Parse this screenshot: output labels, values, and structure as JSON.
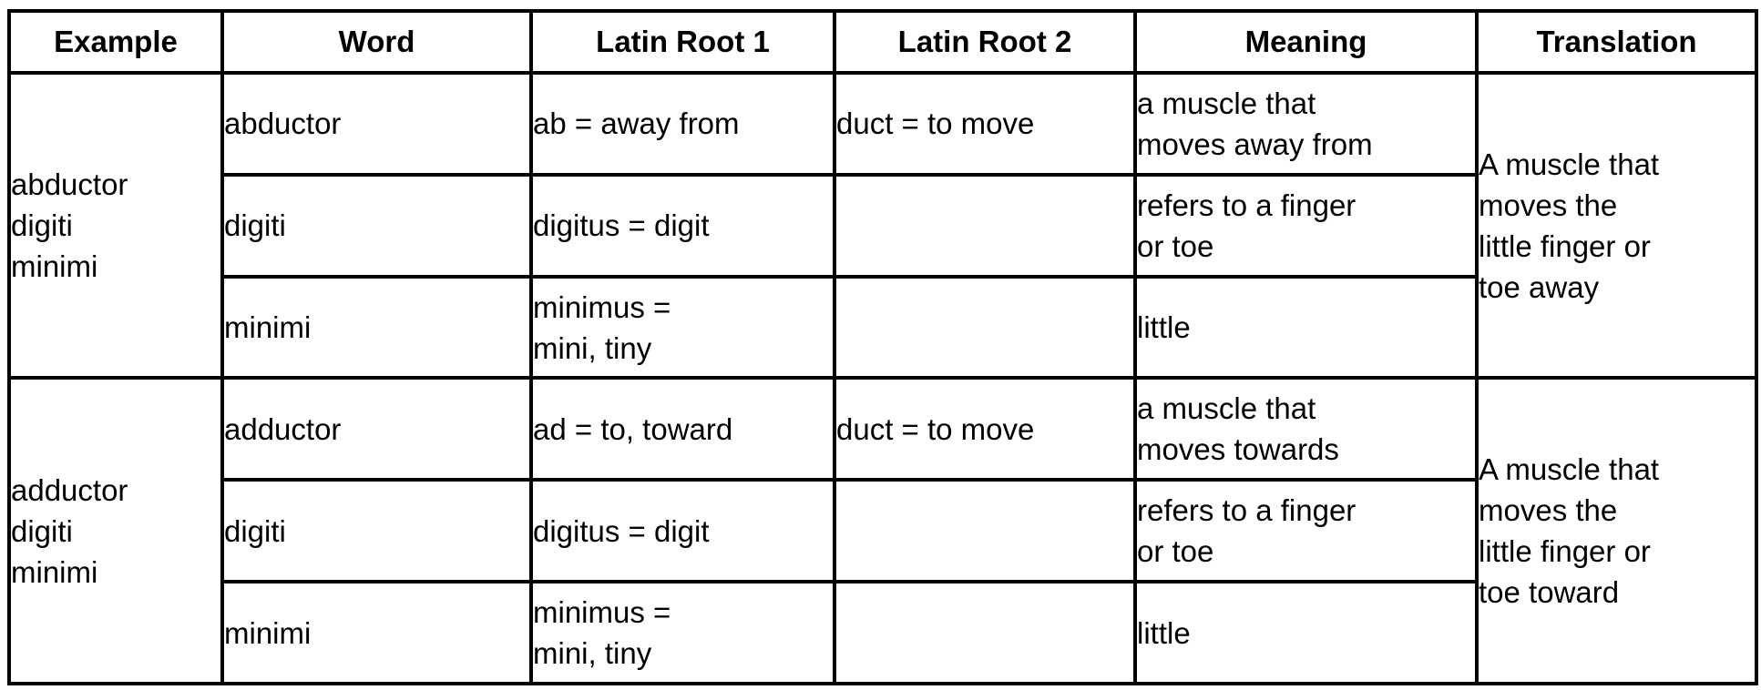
{
  "table": {
    "headers": [
      "Example",
      "Word",
      "Latin Root 1",
      "Latin Root 2",
      "Meaning",
      "Translation"
    ],
    "groups": [
      {
        "example": [
          "abductor",
          "digiti",
          "minimi"
        ],
        "translation": [
          "A muscle that",
          "moves the",
          "little finger or",
          "toe away"
        ],
        "rows": [
          {
            "word": "abductor",
            "root1": [
              "ab = away from"
            ],
            "root2": "duct = to move",
            "meaning": [
              "a muscle that",
              "moves away from"
            ]
          },
          {
            "word": "digiti",
            "root1": [
              "digitus = digit"
            ],
            "root2": "",
            "meaning": [
              "refers to a finger",
              "or toe"
            ]
          },
          {
            "word": "minimi",
            "root1": [
              "minimus =",
              "mini, tiny"
            ],
            "root2": "",
            "meaning": [
              "little"
            ]
          }
        ]
      },
      {
        "example": [
          "adductor",
          "digiti",
          "minimi"
        ],
        "translation": [
          "A muscle that",
          "moves the",
          "little finger or",
          "toe toward"
        ],
        "rows": [
          {
            "word": "adductor",
            "root1": [
              "ad = to, toward"
            ],
            "root2": "duct = to move",
            "meaning": [
              "a muscle that",
              "moves towards"
            ]
          },
          {
            "word": "digiti",
            "root1": [
              "digitus = digit"
            ],
            "root2": "",
            "meaning": [
              "refers to a finger",
              "or toe"
            ]
          },
          {
            "word": "minimi",
            "root1": [
              "minimus =",
              "mini, tiny"
            ],
            "root2": "",
            "meaning": [
              "little"
            ]
          }
        ]
      }
    ]
  }
}
